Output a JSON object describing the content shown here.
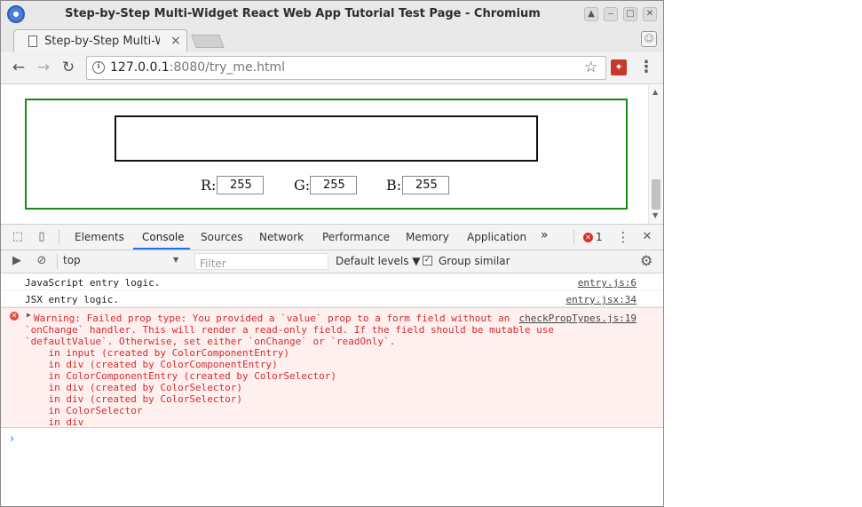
{
  "window": {
    "title": "Step-by-Step Multi-Widget React Web App Tutorial Test Page - Chromium"
  },
  "tab": {
    "title": "Step-by-Step Multi-W",
    "close_label": "×"
  },
  "toolbar": {
    "back": "←",
    "forward": "→",
    "reload": "↻",
    "url_host": "127.0.0.1",
    "url_rest": ":8080/try_me.html",
    "star": "☆",
    "menu": "⋮"
  },
  "page": {
    "swatch_color": "#ffffff",
    "entries": [
      {
        "label": "R:",
        "value": "255"
      },
      {
        "label": "G:",
        "value": "255"
      },
      {
        "label": "B:",
        "value": "255"
      }
    ]
  },
  "devtools": {
    "tabs": [
      "Elements",
      "Console",
      "Sources",
      "Network",
      "Performance",
      "Memory",
      "Application"
    ],
    "active_tab": "Console",
    "more": "»",
    "error_count": "1",
    "menu": "⋮",
    "close": "✕",
    "context": "top",
    "filter_placeholder": "Filter",
    "levels": "Default levels ▼",
    "group_similar": "Group similar",
    "group_checked": "✓",
    "messages": [
      {
        "text": "JavaScript entry logic.",
        "source": "entry.js:6"
      },
      {
        "text": "JSX entry logic.",
        "source": "entry.jsx:34"
      }
    ],
    "error": {
      "source": "checkPropTypes.js:19",
      "lines": [
        "Warning: Failed prop type: You provided a `value` prop to a form field without an",
        "`onChange` handler. This will render a read-only field. If the field should be mutable use",
        "`defaultValue`. Otherwise, set either `onChange` or `readOnly`.",
        "    in input (created by ColorComponentEntry)",
        "    in div (created by ColorComponentEntry)",
        "    in ColorComponentEntry (created by ColorSelector)",
        "    in div (created by ColorSelector)",
        "    in div (created by ColorSelector)",
        "    in ColorSelector",
        "    in div"
      ]
    },
    "prompt": "›"
  }
}
